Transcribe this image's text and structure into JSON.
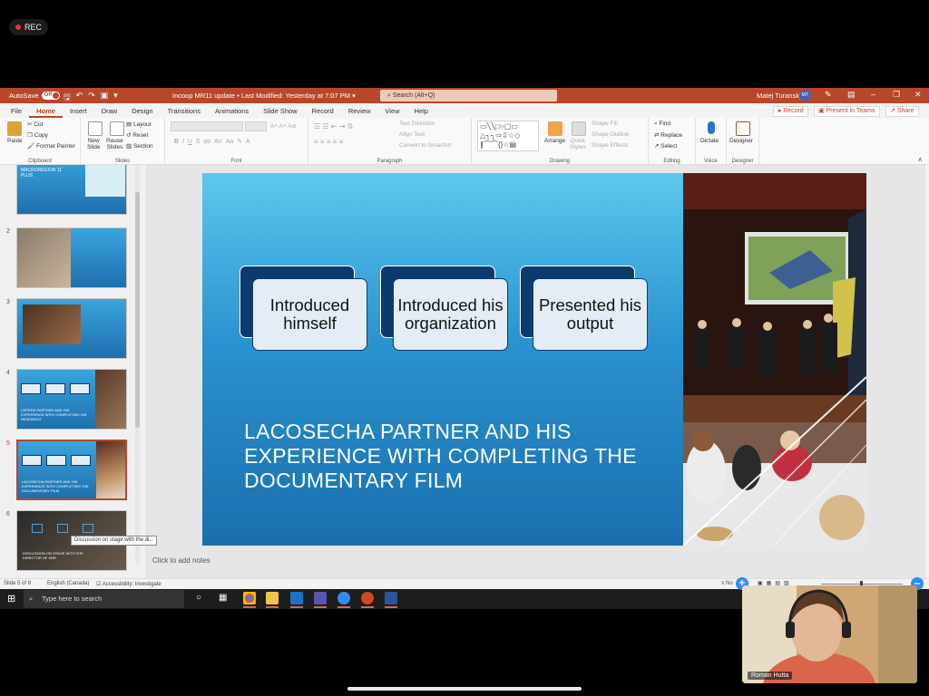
{
  "recording": {
    "label": "REC"
  },
  "window": {
    "autosave_label": "AutoSave",
    "autosave_state": "Off",
    "doc_title": "Incoop MR11 update",
    "last_modified": "Last Modified: Yesterday at 7:07 PM",
    "search_placeholder": "Search (Alt+Q)",
    "user_name": "Matej Turansky",
    "user_initials": "MT"
  },
  "tabs": [
    "File",
    "Home",
    "Insert",
    "Draw",
    "Design",
    "Transitions",
    "Animations",
    "Slide Show",
    "Record",
    "Review",
    "View",
    "Help"
  ],
  "active_tab": "Home",
  "tab_actions": {
    "record": "Record",
    "present_in_teams": "Present in Teams",
    "share": "Share"
  },
  "ribbon": {
    "clipboard": {
      "label": "Clipboard",
      "paste": "Paste",
      "cut": "Cut",
      "copy": "Copy",
      "format_painter": "Format Painter"
    },
    "slides": {
      "label": "Slides",
      "new_slide_1": "New",
      "new_slide_2": "Slide",
      "reuse_1": "Reuse",
      "reuse_2": "Slides",
      "layout": "Layout",
      "reset": "Reset",
      "section": "Section"
    },
    "font": {
      "label": "Font"
    },
    "paragraph": {
      "label": "Paragraph",
      "text_direction": "Text Direction",
      "align_text": "Align Text",
      "convert_smartart": "Convert to SmartArt"
    },
    "drawing": {
      "label": "Drawing",
      "arrange": "Arrange",
      "quick_styles_1": "Quick",
      "quick_styles_2": "Styles",
      "shape_fill": "Shape Fill",
      "shape_outline": "Shape Outline",
      "shape_effects": "Shape Effects"
    },
    "editing": {
      "label": "Editing",
      "find": "Find",
      "replace": "Replace",
      "select": "Select"
    },
    "voice": {
      "label": "Voice",
      "dictate": "Dictate"
    },
    "designer": {
      "label": "Designer",
      "designer": "Designer"
    }
  },
  "thumbnails": [
    {
      "num": "",
      "text": "MACROREGION 11 PLUS"
    },
    {
      "num": "2",
      "text": ""
    },
    {
      "num": "3",
      "text": ""
    },
    {
      "num": "4",
      "text": "CEPEDE PARTNER AND HIS EXPERIENCE WITH COMPLETING HIS RESEARCH"
    },
    {
      "num": "5",
      "text": "LACOSECHA PARTNER AND HIS EXPERIENCE WITH COMPLETING THE DOCUMENTARY FILM"
    },
    {
      "num": "6",
      "text": "DISCUSSION ON STAGE WITH THE DIRECTOR OF KBR"
    }
  ],
  "tooltip": "Discussion on stage with the di...",
  "slide": {
    "boxes": [
      "Introduced himself",
      "Introduced his organization",
      "Presented his output"
    ],
    "title": "LACOSECHA PARTNER AND HIS EXPERIENCE WITH COMPLETING THE DOCUMENTARY FILM"
  },
  "notes_placeholder": "Click to add notes",
  "status": {
    "slide": "Slide 5 of 8",
    "language": "English (Canada)",
    "accessibility": "Accessibility: Investigate",
    "notes": "No"
  },
  "taskbar": {
    "search": "Type here to search"
  },
  "camera": {
    "name": "Roman Hutta"
  },
  "colors": {
    "ppt_accent": "#b7472a",
    "slide_blue": "#2a93cf",
    "box_dark": "#0d3a6e"
  }
}
